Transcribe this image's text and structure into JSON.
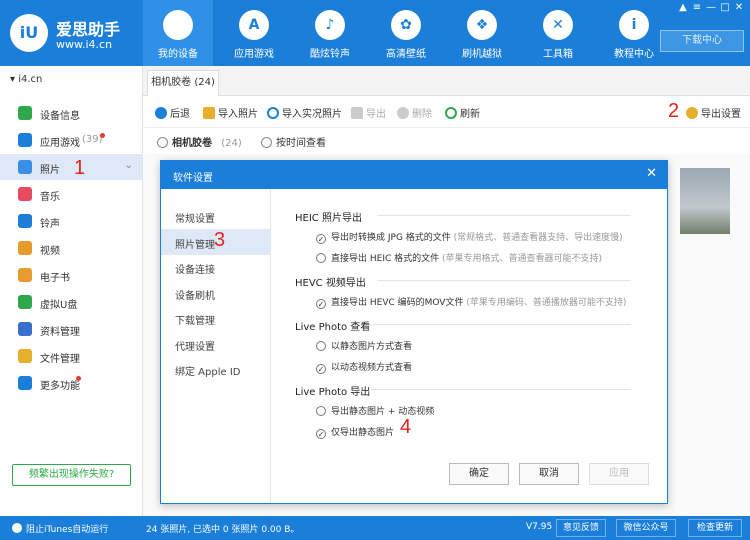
{
  "app": {
    "logo_mark": "iU",
    "name": "爱思助手",
    "url": "www.i4.cn",
    "download_center": "下载中心"
  },
  "window_controls": [
    "shirt-icon",
    "menu-icon",
    "minimize-icon",
    "maximize-icon",
    "close-icon"
  ],
  "nav": [
    {
      "label": "我的设备",
      "icon": "apple-icon",
      "glyph": "",
      "active": true
    },
    {
      "label": "应用游戏",
      "icon": "app-store-icon",
      "glyph": "A"
    },
    {
      "label": "酷炫铃声",
      "icon": "bell-icon",
      "glyph": "♪"
    },
    {
      "label": "高清壁纸",
      "icon": "flower-icon",
      "glyph": "✿"
    },
    {
      "label": "刷机越狱",
      "icon": "dropbox-icon",
      "glyph": "❖"
    },
    {
      "label": "工具箱",
      "icon": "tools-icon",
      "glyph": "✕"
    },
    {
      "label": "教程中心",
      "icon": "info-icon",
      "glyph": "i"
    }
  ],
  "sidebar": {
    "device": "i4.cn",
    "items": [
      {
        "label": "设备信息",
        "icon": "info-icon",
        "color": "#2ea84a"
      },
      {
        "label": "应用游戏",
        "count": "(39)",
        "icon": "app-store-icon",
        "color": "#1b7fd9",
        "badge": true
      },
      {
        "label": "照片",
        "icon": "photo-icon",
        "color": "#3a8ee6",
        "active": true
      },
      {
        "label": "音乐",
        "icon": "music-icon",
        "color": "#e84a5f"
      },
      {
        "label": "铃声",
        "icon": "bell-icon",
        "color": "#1b7fd9"
      },
      {
        "label": "视频",
        "icon": "video-icon",
        "color": "#e69b2e"
      },
      {
        "label": "电子书",
        "icon": "book-icon",
        "color": "#e69b2e"
      },
      {
        "label": "虚拟U盘",
        "icon": "usb-icon",
        "color": "#2ea84a"
      },
      {
        "label": "资料管理",
        "icon": "contacts-icon",
        "color": "#3a6fd0"
      },
      {
        "label": "文件管理",
        "icon": "folder-icon",
        "color": "#e6b02e"
      },
      {
        "label": "更多功能",
        "icon": "grid-icon",
        "color": "#1b7fd9",
        "badge": true
      }
    ],
    "fix_button": "频繁出现操作失败?"
  },
  "tab": "相机胶卷 (24)",
  "toolbar": {
    "back": "后退",
    "import_photo": "导入照片",
    "import_live": "导入实况照片",
    "export": "导出",
    "delete": "删除",
    "refresh": "刷新",
    "export_settings": "导出设置"
  },
  "subbar": {
    "camera_roll": "相机胶卷",
    "camera_roll_count": "(24)",
    "by_time": "按时间查看"
  },
  "annotations": [
    "1",
    "2",
    "3",
    "4"
  ],
  "dialog": {
    "title": "软件设置",
    "nav": [
      "常规设置",
      "照片管理",
      "设备连接",
      "设备刷机",
      "下载管理",
      "代理设置",
      "绑定 Apple ID"
    ],
    "sections": [
      {
        "title": "HEIC 照片导出",
        "options": [
          {
            "label": "导出时转换成 JPG 格式的文件",
            "hint": "(常规格式、普通查看器支持、导出速度慢)",
            "checked": true
          },
          {
            "label": "直接导出 HEIC 格式的文件",
            "hint": "(苹果专用格式、普通查看器可能不支持)",
            "checked": false
          }
        ]
      },
      {
        "title": "HEVC 视频导出",
        "options": [
          {
            "label": "直接导出 HEVC 编码的MOV文件",
            "hint": "(苹果专用编码、普通播放器可能不支持)",
            "checked": true
          }
        ]
      },
      {
        "title": "Live Photo 查看",
        "options": [
          {
            "label": "以静态图片方式查看",
            "hint": "",
            "checked": false
          },
          {
            "label": "以动态视频方式查看",
            "hint": "",
            "checked": true
          }
        ]
      },
      {
        "title": "Live Photo 导出",
        "options": [
          {
            "label": "导出静态图片 + 动态视频",
            "hint": "",
            "checked": false
          },
          {
            "label": "仅导出静态图片",
            "hint": "",
            "checked": true
          }
        ]
      }
    ],
    "buttons": {
      "ok": "确定",
      "cancel": "取消",
      "apply": "应用"
    }
  },
  "status": {
    "itunes": "阻止iTunes自动运行",
    "summary": "24 张照片, 已选中 0 张照片 0.00 B。",
    "version": "V7.95",
    "feedback": "意见反馈",
    "wechat": "微信公众号",
    "update": "检查更新"
  }
}
